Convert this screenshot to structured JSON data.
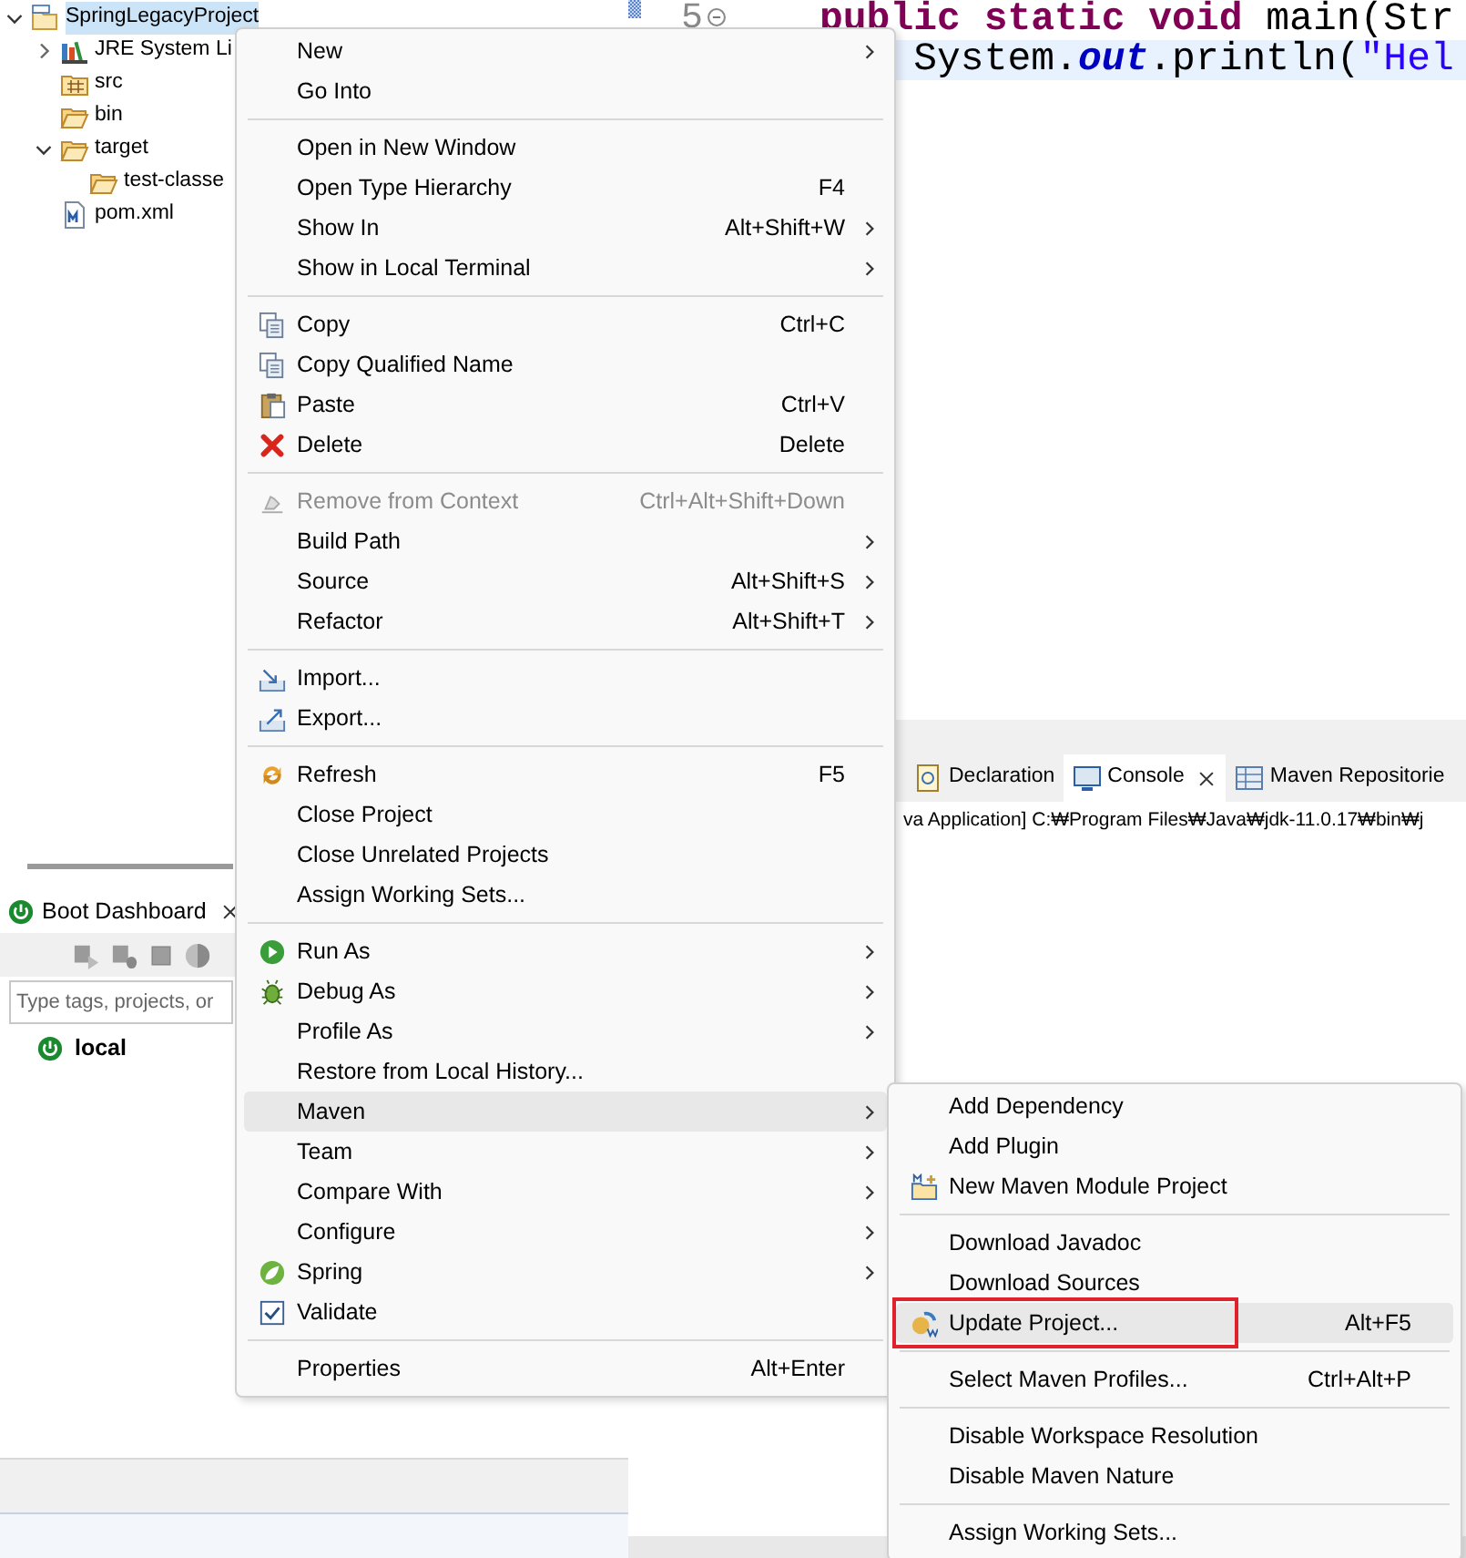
{
  "explorer": {
    "tree": [
      {
        "label": "SpringLegacyProject",
        "kind": "project",
        "expanded": true,
        "selected": true,
        "children": [
          {
            "label": "JRE System Li",
            "kind": "library",
            "expanded": false,
            "selected": false
          },
          {
            "label": "src",
            "kind": "package-folder",
            "selected": false
          },
          {
            "label": "bin",
            "kind": "folder",
            "selected": false
          },
          {
            "label": "target",
            "kind": "folder",
            "expanded": true,
            "selected": false,
            "children": [
              {
                "label": "test-classe",
                "kind": "folder",
                "selected": false
              }
            ]
          },
          {
            "label": "pom.xml",
            "kind": "maven-file",
            "selected": false
          }
        ]
      }
    ]
  },
  "editor": {
    "line_number": "5",
    "lines": [
      {
        "current": false,
        "tokens": [
          {
            "kind": "keyword",
            "text": "public static void"
          },
          {
            "kind": "plain",
            "text": " main(Str"
          }
        ]
      },
      {
        "current": true,
        "tokens": [
          {
            "kind": "plain",
            "text": "    System."
          },
          {
            "kind": "field",
            "text": "out"
          },
          {
            "kind": "plain",
            "text": ".println("
          },
          {
            "kind": "string",
            "text": "\"Hel"
          }
        ]
      }
    ]
  },
  "console": {
    "tabs": [
      {
        "label": "Declaration",
        "kind": "declaration",
        "selected": false,
        "closable": false
      },
      {
        "label": "Console",
        "kind": "console",
        "selected": true,
        "closable": true
      },
      {
        "label": "Maven Repositorie",
        "kind": "repository",
        "selected": false,
        "closable": false
      }
    ],
    "output": "va Application] C:₩Program Files₩Java₩jdk-11.0.17₩bin₩j"
  },
  "boot_dashboard": {
    "title": "Boot Dashboard",
    "search_placeholder": "Type tags, projects, or",
    "items": [
      {
        "label": "local"
      }
    ]
  },
  "context_menu": {
    "items": [
      {
        "kind": "plain",
        "label": "New",
        "submenu": true,
        "disabled": false,
        "selected": false
      },
      {
        "kind": "plain",
        "label": "Go Into",
        "submenu": false,
        "disabled": false,
        "selected": false
      },
      {
        "kind": "separator"
      },
      {
        "kind": "plain",
        "label": "Open in New Window",
        "submenu": false,
        "disabled": false,
        "selected": false
      },
      {
        "kind": "plain",
        "label": "Open Type Hierarchy",
        "shortcut": "F4",
        "submenu": false,
        "disabled": false,
        "selected": false
      },
      {
        "kind": "plain",
        "label": "Show In",
        "shortcut": "Alt+Shift+W",
        "submenu": true,
        "disabled": false,
        "selected": false
      },
      {
        "kind": "plain",
        "label": "Show in Local Terminal",
        "submenu": true,
        "disabled": false,
        "selected": false
      },
      {
        "kind": "separator"
      },
      {
        "kind": "copy",
        "label": "Copy",
        "shortcut": "Ctrl+C",
        "submenu": false,
        "disabled": false,
        "selected": false
      },
      {
        "kind": "copy",
        "label": "Copy Qualified Name",
        "submenu": false,
        "disabled": false,
        "selected": false
      },
      {
        "kind": "paste",
        "label": "Paste",
        "shortcut": "Ctrl+V",
        "submenu": false,
        "disabled": false,
        "selected": false
      },
      {
        "kind": "delete",
        "label": "Delete",
        "shortcut": "Delete",
        "submenu": false,
        "disabled": false,
        "selected": false
      },
      {
        "kind": "separator"
      },
      {
        "kind": "remove-context",
        "label": "Remove from Context",
        "shortcut": "Ctrl+Alt+Shift+Down",
        "submenu": false,
        "disabled": true,
        "selected": false
      },
      {
        "kind": "plain",
        "label": "Build Path",
        "submenu": true,
        "disabled": false,
        "selected": false
      },
      {
        "kind": "plain",
        "label": "Source",
        "shortcut": "Alt+Shift+S",
        "submenu": true,
        "disabled": false,
        "selected": false
      },
      {
        "kind": "plain",
        "label": "Refactor",
        "shortcut": "Alt+Shift+T",
        "submenu": true,
        "disabled": false,
        "selected": false
      },
      {
        "kind": "separator"
      },
      {
        "kind": "import",
        "label": "Import...",
        "submenu": false,
        "disabled": false,
        "selected": false
      },
      {
        "kind": "export",
        "label": "Export...",
        "submenu": false,
        "disabled": false,
        "selected": false
      },
      {
        "kind": "separator"
      },
      {
        "kind": "refresh",
        "label": "Refresh",
        "shortcut": "F5",
        "submenu": false,
        "disabled": false,
        "selected": false
      },
      {
        "kind": "plain",
        "label": "Close Project",
        "submenu": false,
        "disabled": false,
        "selected": false
      },
      {
        "kind": "plain",
        "label": "Close Unrelated Projects",
        "submenu": false,
        "disabled": false,
        "selected": false
      },
      {
        "kind": "plain",
        "label": "Assign Working Sets...",
        "submenu": false,
        "disabled": false,
        "selected": false
      },
      {
        "kind": "separator"
      },
      {
        "kind": "run",
        "label": "Run As",
        "submenu": true,
        "disabled": false,
        "selected": false
      },
      {
        "kind": "debug",
        "label": "Debug As",
        "submenu": true,
        "disabled": false,
        "selected": false
      },
      {
        "kind": "plain",
        "label": "Profile As",
        "submenu": true,
        "disabled": false,
        "selected": false
      },
      {
        "kind": "plain",
        "label": "Restore from Local History...",
        "submenu": false,
        "disabled": false,
        "selected": false
      },
      {
        "kind": "plain",
        "label": "Maven",
        "submenu": true,
        "disabled": false,
        "selected": true
      },
      {
        "kind": "plain",
        "label": "Team",
        "submenu": true,
        "disabled": false,
        "selected": false
      },
      {
        "kind": "plain",
        "label": "Compare With",
        "submenu": true,
        "disabled": false,
        "selected": false
      },
      {
        "kind": "plain",
        "label": "Configure",
        "submenu": true,
        "disabled": false,
        "selected": false
      },
      {
        "kind": "spring",
        "label": "Spring",
        "submenu": true,
        "disabled": false,
        "selected": false
      },
      {
        "kind": "check",
        "label": "Validate",
        "submenu": false,
        "disabled": false,
        "selected": false
      },
      {
        "kind": "separator"
      },
      {
        "kind": "plain",
        "label": "Properties",
        "shortcut": "Alt+Enter",
        "submenu": false,
        "disabled": false,
        "selected": false
      }
    ]
  },
  "maven_submenu": {
    "items": [
      {
        "kind": "plain",
        "label": "Add Dependency",
        "selected": false,
        "outlined": false
      },
      {
        "kind": "plain",
        "label": "Add Plugin",
        "selected": false,
        "outlined": false
      },
      {
        "kind": "maven-module",
        "label": "New Maven Module Project",
        "selected": false,
        "outlined": false
      },
      {
        "kind": "separator"
      },
      {
        "kind": "plain",
        "label": "Download Javadoc",
        "selected": false,
        "outlined": false
      },
      {
        "kind": "plain",
        "label": "Download Sources",
        "selected": false,
        "outlined": false
      },
      {
        "kind": "update",
        "label": "Update Project...",
        "shortcut": "Alt+F5",
        "selected": true,
        "outlined": true
      },
      {
        "kind": "separator"
      },
      {
        "kind": "plain",
        "label": "Select Maven Profiles...",
        "shortcut": "Ctrl+Alt+P",
        "selected": false,
        "outlined": false
      },
      {
        "kind": "separator"
      },
      {
        "kind": "plain",
        "label": "Disable Workspace Resolution",
        "selected": false,
        "outlined": false
      },
      {
        "kind": "plain",
        "label": "Disable Maven Nature",
        "selected": false,
        "outlined": false
      },
      {
        "kind": "separator"
      },
      {
        "kind": "plain",
        "label": "Assign Working Sets...",
        "selected": false,
        "outlined": false
      }
    ]
  }
}
